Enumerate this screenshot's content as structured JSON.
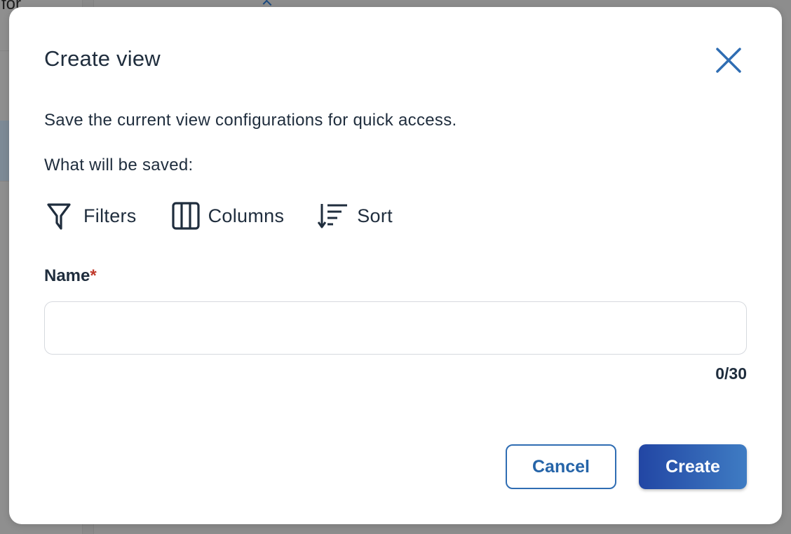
{
  "background": {
    "partial_text": "for"
  },
  "modal": {
    "title": "Create view",
    "description": "Save the current view configurations for quick access.",
    "saved_heading": "What will be saved:",
    "saved_items": [
      {
        "label": "Filters",
        "icon": "filter-icon"
      },
      {
        "label": "Columns",
        "icon": "columns-icon"
      },
      {
        "label": "Sort",
        "icon": "sort-icon"
      }
    ],
    "name_field": {
      "label": "Name",
      "required_marker": "*",
      "value": "",
      "placeholder": "",
      "char_count": "0/30"
    },
    "buttons": {
      "cancel": "Cancel",
      "create": "Create"
    },
    "close_icon": "close-icon"
  },
  "colors": {
    "text_primary": "#1f2d3d",
    "accent": "#2f6db3",
    "required": "#c0392b",
    "create_gradient_start": "#2246a4",
    "create_gradient_end": "#3f7cc3"
  }
}
